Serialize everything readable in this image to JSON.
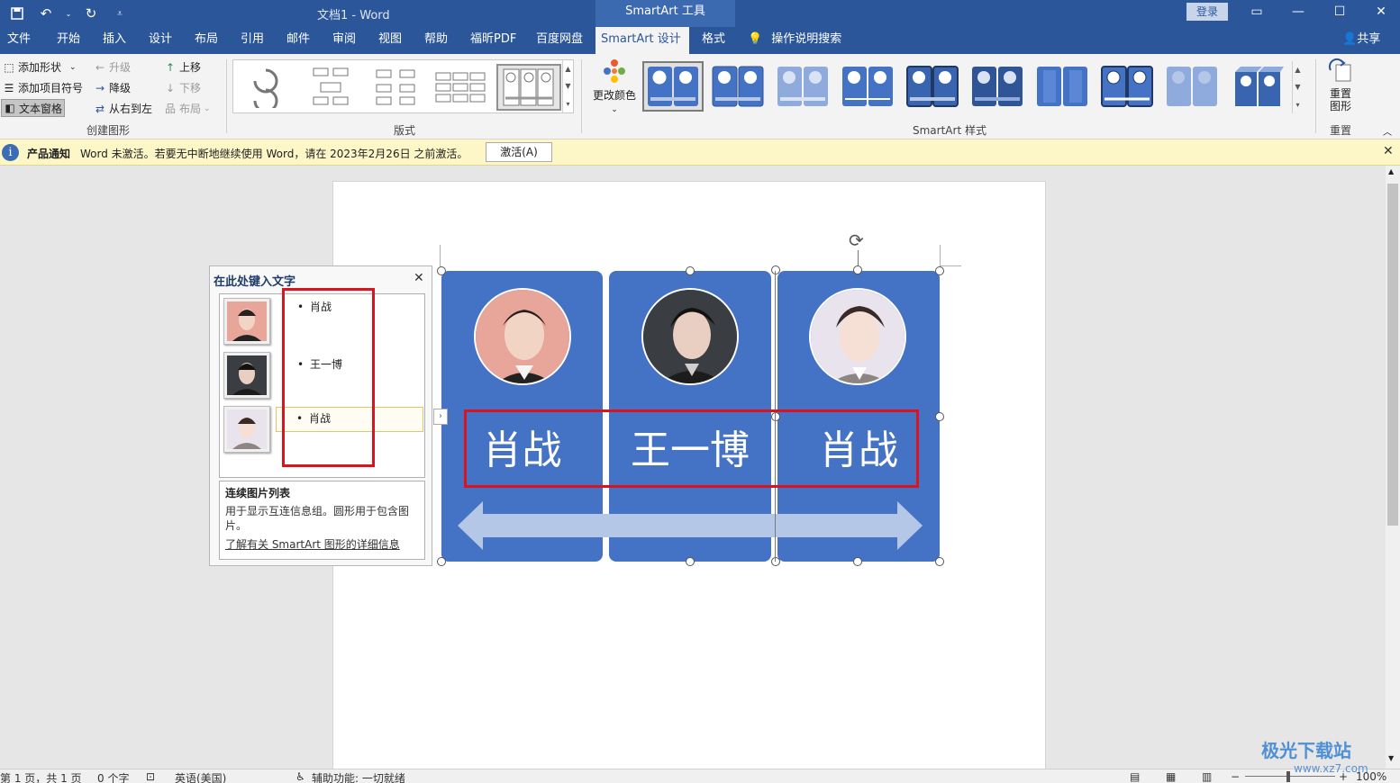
{
  "app": {
    "doc_title": "文档1 - Word",
    "context_tool": "SmartArt 工具",
    "login": "登录",
    "share": "共享"
  },
  "tabs": [
    "文件",
    "开始",
    "插入",
    "设计",
    "布局",
    "引用",
    "邮件",
    "审阅",
    "视图",
    "帮助",
    "福昕PDF",
    "百度网盘",
    "SmartArt 设计",
    "格式"
  ],
  "active_tab": "SmartArt 设计",
  "search_label": "操作说明搜索",
  "ribbon": {
    "create": {
      "add_shape": "添加形状",
      "add_bullet": "添加项目符号",
      "text_pane": "文本窗格",
      "promote": "升级",
      "demote": "降级",
      "rtl": "从右到左",
      "move_up": "上移",
      "move_down": "下移",
      "layout": "布局",
      "group_label": "创建图形"
    },
    "layouts_label": "版式",
    "change_colors": "更改颜色",
    "styles_label": "SmartArt 样式",
    "reset_graphic": "重置图形",
    "reset_label": "重置"
  },
  "notification": {
    "title": "产品通知",
    "message": "Word 未激活。若要无中断地继续使用 Word，请在 2023年2月26日 之前激活。",
    "button": "激活(A)"
  },
  "text_pane": {
    "title": "在此处键入文字",
    "items": [
      "肖战",
      "王一博",
      "肖战"
    ],
    "desc_title": "连续图片列表",
    "desc_body": "用于显示互连信息组。圆形用于包含图片。",
    "desc_link": "了解有关 SmartArt 图形的详细信息"
  },
  "smartart": {
    "names": [
      "肖战",
      "王一博",
      "肖战"
    ],
    "fill_color": "#4472c4",
    "arrow_color": "#b4c7e7"
  },
  "status": {
    "page": "第 1 页，共 1 页",
    "words": "0 个字",
    "language": "英语(美国)",
    "accessibility": "辅助功能: 一切就绪",
    "zoom": "100%"
  },
  "watermark": {
    "line1": "极光下载站",
    "line2": "www.xz7.com"
  }
}
